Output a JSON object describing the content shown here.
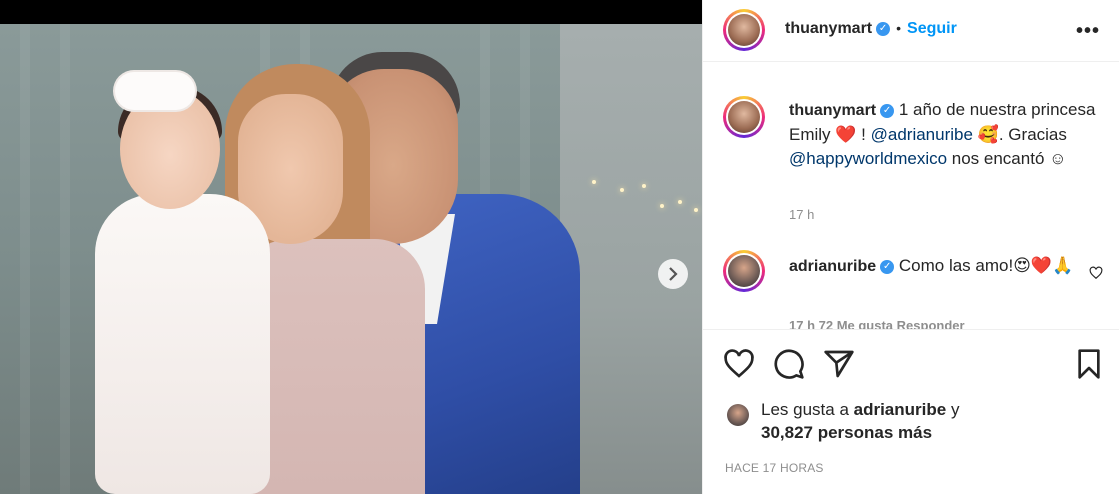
{
  "post": {
    "author": "thuanymart",
    "follow_label": "Seguir",
    "separator": "•",
    "more_label": "•••",
    "caption_parts": {
      "text1": "1 año de nuestra princesa Emily ",
      "emoji_heart": "❤️",
      "text2": " ! ",
      "mention1": "@adrianuribe",
      "emoji_face": "🥰",
      "text3": ". Gracias ",
      "mention2": "@happyworldmexico",
      "text4": " nos encantó ☺"
    },
    "caption_time": "17 h"
  },
  "comment": {
    "author": "adrianuribe",
    "text": "Como las amo!",
    "emojis": "😍❤️🙏",
    "meta_cut": "17 h     72 Me gusta     Responder"
  },
  "likes": {
    "line1_prefix": "Les gusta a ",
    "line1_user": "adrianuribe",
    "line1_suffix": " y",
    "line2": "30,827 personas más"
  },
  "posted_label": "HACE 17 HORAS",
  "colors": {
    "accent_blue": "#0095f6",
    "verified_blue": "#3897f0",
    "mention_blue": "#00376b",
    "meta_grey": "#8e8e8e"
  },
  "icons": {
    "next": "chevron-right-icon",
    "like": "heart-outline-icon",
    "comment": "comment-bubble-icon",
    "share": "paper-plane-icon",
    "save": "bookmark-icon",
    "verified": "verified-badge-icon",
    "more": "ellipsis-icon"
  }
}
